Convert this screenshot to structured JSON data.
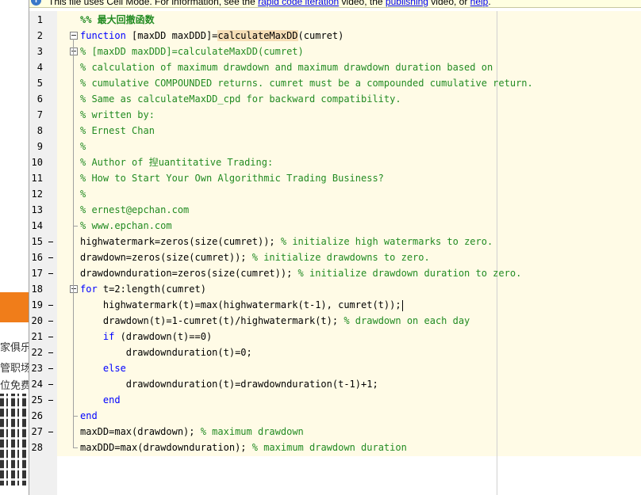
{
  "background_window": {
    "texts": [
      "家俱乐",
      "管职场",
      "位免费"
    ]
  },
  "info_bar": {
    "prefix": "This file uses Cell Mode. For information, see the ",
    "link1": "rapid code iteration",
    "mid1": " video, the ",
    "link2": "publishing",
    "mid2": " video, or ",
    "link3": "help",
    "suffix": "."
  },
  "colors": {
    "keyword": "#0000ff",
    "comment": "#228b22",
    "cell_background": "#fffbe6",
    "function_highlight": "#f6deb6"
  },
  "lines": [
    {
      "n": "1",
      "t1": "%% 最大回撤函数"
    },
    {
      "n": "2",
      "kw": "function",
      "t1": " [maxDD maxDDD]=",
      "hl": "calculateMaxDD",
      "t2": "(cumret)"
    },
    {
      "n": "3",
      "t1": "% [maxDD maxDDD]=calculateMaxDD(cumret)"
    },
    {
      "n": "4",
      "t1": "% calculation of maximum drawdown and maximum drawdown duration based on"
    },
    {
      "n": "5",
      "t1": "% cumulative COMPOUNDED returns. cumret must be a compounded cumulative return."
    },
    {
      "n": "6",
      "t1": "% Same as calculateMaxDD_cpd for backward compatibility."
    },
    {
      "n": "7",
      "t1": "% written by:"
    },
    {
      "n": "8",
      "t1": "% Ernest Chan"
    },
    {
      "n": "9",
      "t1": "%"
    },
    {
      "n": "10",
      "t1": "% Author of 揑uantitative Trading:"
    },
    {
      "n": "11",
      "t1": "% How to Start Your Own Algorithmic Trading Business?"
    },
    {
      "n": "12",
      "t1": "%"
    },
    {
      "n": "13",
      "t1": "% ernest@epchan.com"
    },
    {
      "n": "14",
      "t1": "% www.epchan.com"
    },
    {
      "n": "15",
      "t1": "highwatermark=zeros(size(cumret)); ",
      "cm": "% initialize high watermarks to zero."
    },
    {
      "n": "16",
      "t1": "drawdown=zeros(size(cumret)); ",
      "cm": "% initialize drawdowns to zero."
    },
    {
      "n": "17",
      "t1": "drawdownduration=zeros(size(cumret)); ",
      "cm": "% initialize drawdown duration to zero."
    },
    {
      "n": "18",
      "kw": "for",
      "t1": " t=2:length(cumret)"
    },
    {
      "n": "19",
      "t1": "    highwatermark(t)=max(highwatermark(t-1), cumret(t));"
    },
    {
      "n": "20",
      "t1": "    drawdown(t)=1-cumret(t)/highwatermark(t); ",
      "cm": "% drawdown on each day"
    },
    {
      "n": "21",
      "kw": "    if",
      "t1": " (drawdown(t)==0)"
    },
    {
      "n": "22",
      "t1": "        drawdownduration(t)=0;"
    },
    {
      "n": "23",
      "kw": "    else"
    },
    {
      "n": "24",
      "t1": "        drawdownduration(t)=drawdownduration(t-1)+1;"
    },
    {
      "n": "25",
      "kw": "    end"
    },
    {
      "n": "26",
      "kw": "end"
    },
    {
      "n": "27",
      "t1": "maxDD=max(drawdown); ",
      "cm": "% maximum drawdown"
    },
    {
      "n": "28",
      "t1": "maxDDD=max(drawdownduration); ",
      "cm": "% maximum drawdown duration"
    }
  ]
}
